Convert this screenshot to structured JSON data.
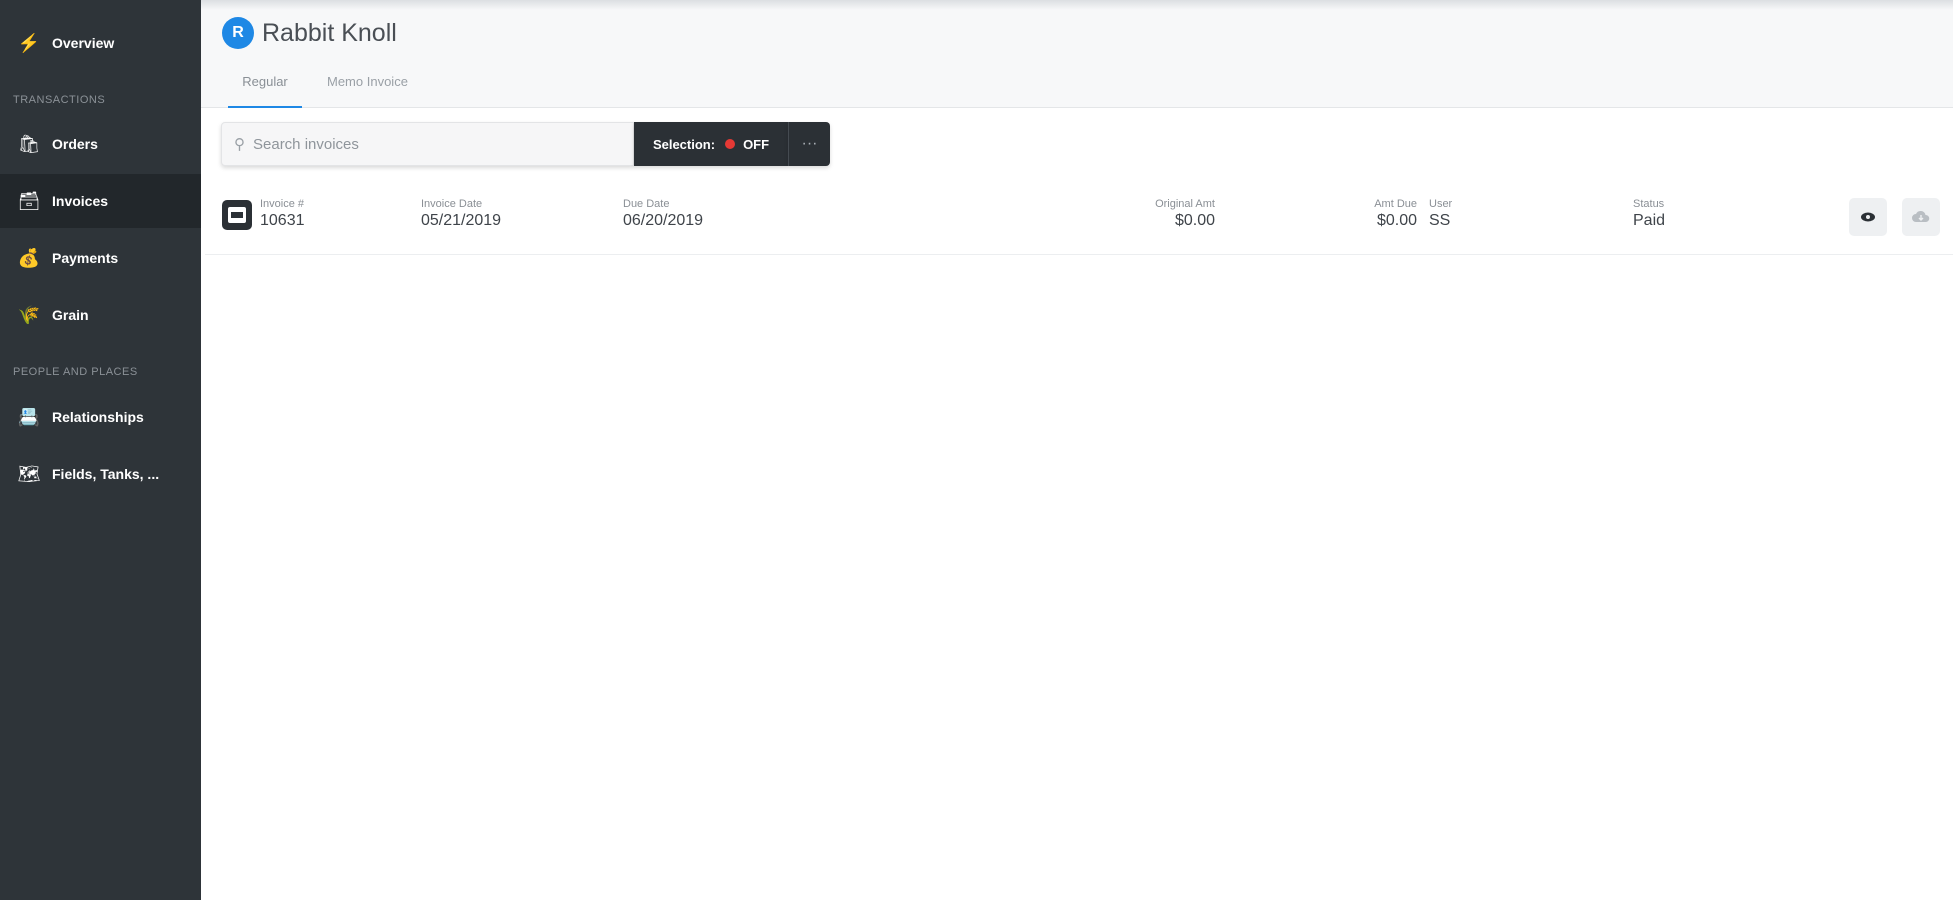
{
  "sidebar": {
    "items": [
      {
        "label": "Overview",
        "icon": "lightning-icon"
      },
      {
        "label": "Orders",
        "icon": "orders-icon"
      },
      {
        "label": "Invoices",
        "icon": "invoice-icon"
      },
      {
        "label": "Payments",
        "icon": "payments-icon"
      },
      {
        "label": "Grain",
        "icon": "grain-icon"
      },
      {
        "label": "Relationships",
        "icon": "contacts-icon"
      },
      {
        "label": "Fields, Tanks, ...",
        "icon": "fields-icon"
      }
    ],
    "sections": [
      "TRANSACTIONS",
      "PEOPLE AND PLACES"
    ],
    "active": "Invoices"
  },
  "header": {
    "logo_letter": "R",
    "title": "Rabbit Knoll",
    "tabs": [
      {
        "label": "Regular"
      },
      {
        "label": "Memo Invoice"
      }
    ]
  },
  "toolbar": {
    "search_placeholder": "Search invoices",
    "selection_label": "Selection:",
    "selection_state": "OFF",
    "more_label": "···"
  },
  "invoices": [
    {
      "invoice_no_label": "Invoice #",
      "invoice_no": "10631",
      "invoice_date_label": "Invoice Date",
      "invoice_date": "05/21/2019",
      "due_date_label": "Due Date",
      "due_date": "06/20/2019",
      "original_amt_label": "Original Amt",
      "original_amt": "$0.00",
      "amt_due_label": "Amt Due",
      "amt_due": "$0.00",
      "user_label": "User",
      "user": "SS",
      "status_label": "Status",
      "status": "Paid"
    }
  ],
  "colors": {
    "accent": "#1e88e5",
    "sidebar": "#2e3439",
    "selection_off_dot": "#e53935"
  }
}
